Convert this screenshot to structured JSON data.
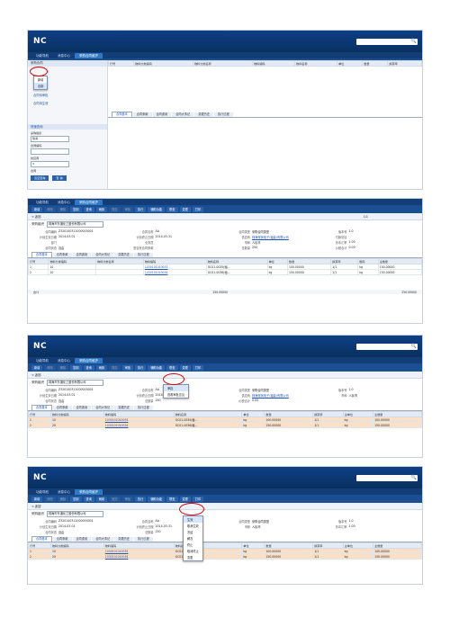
{
  "app": {
    "logo": "NC"
  },
  "tabs": [
    "功能导航",
    "消息中心",
    "采购合同维护"
  ],
  "toolbar1": [
    "新增",
    "修改",
    "删除",
    "复制",
    "查询",
    "刷新",
    "提交",
    "审批",
    "执行",
    "辅助功能",
    "联查",
    "打印"
  ],
  "toolbar2": [
    "新增",
    "修改",
    "删除",
    "复制",
    "查询",
    "刷新",
    "提交",
    "审批",
    "执行",
    "辅助功能",
    "联查",
    "变更",
    "打印"
  ],
  "nav": {
    "back": "< 返回",
    "page": "1/1",
    "org_label": "采购组织",
    "org_value": "珠海市东通化工股份有限公司"
  },
  "left": {
    "header": "采购合同",
    "items": [
      "合同待生效",
      "合同待审批",
      "合同待生效"
    ],
    "query_header": "快速查询",
    "query_labels": [
      "采购组织",
      "合同编码",
      "供应商",
      "合同"
    ],
    "query_values": [
      "珠海",
      "",
      "4"
    ],
    "query_buttons": [
      "清空查询",
      "查 询"
    ]
  },
  "menu1": [
    "新增",
    "自制",
    "采购计划",
    "请购单"
  ],
  "menu3": [
    "审批",
    "查看审批意见"
  ],
  "menu4": [
    "生效",
    "取消生效",
    "冻结",
    "解冻",
    "终止",
    "取消终止",
    "变更"
  ],
  "form": {
    "fields": [
      [
        "合同编码",
        "Z320140311000000001"
      ],
      [
        "合同名称",
        "AA"
      ],
      [
        "合同类型",
        "采购合同类型"
      ],
      [
        "版本号",
        "1.0"
      ],
      [
        "计划生效日期",
        "2014-03-01"
      ],
      [
        "计划终止日期",
        "2014-03-31"
      ],
      [
        "供应商",
        "珠海得润电子(福建)有限公司"
      ],
      [
        "付款协议"
      ],
      [
        "部门",
        ""
      ],
      [
        "业务员",
        ""
      ],
      [
        "币种",
        "人民币"
      ],
      [
        "折本汇率",
        "1.00"
      ],
      [
        "合同状态",
        "自由"
      ],
      [
        "是否有合同条款",
        ""
      ],
      [
        "总数量",
        "250"
      ],
      [
        "价税合计",
        "0.00"
      ]
    ]
  },
  "subtabs": [
    "合同基本",
    "合同条款",
    "合同费用",
    "合同大事记",
    "变更历史",
    "执行过程"
  ],
  "table": {
    "headers": [
      "行号",
      "物料分类编码",
      "物料分类名称",
      "物料编码",
      "物料名称",
      "单位",
      "数量",
      "换算率",
      "税码",
      "主单位",
      "型号",
      "含税价",
      "主数量"
    ],
    "rows": [
      [
        "1",
        "10",
        "",
        "",
        "1030101010033",
        "GC01-0035(粗...",
        "kg",
        "100.00000",
        "1/1",
        "kg",
        "",
        "",
        "100.00000"
      ],
      [
        "2",
        "20",
        "",
        "",
        "1030101010034",
        "GC01-0036(粗...",
        "kg",
        "150.00000",
        "1/1",
        "kg",
        "",
        "",
        "150.00000"
      ]
    ],
    "total_label": "合计",
    "total_qty": "250.00000",
    "total_main": "250.00000"
  },
  "colors": {
    "header": "#08305f",
    "accent": "#2a63ac",
    "highlight": "#fbe0c8",
    "annotation": "#e00000"
  }
}
